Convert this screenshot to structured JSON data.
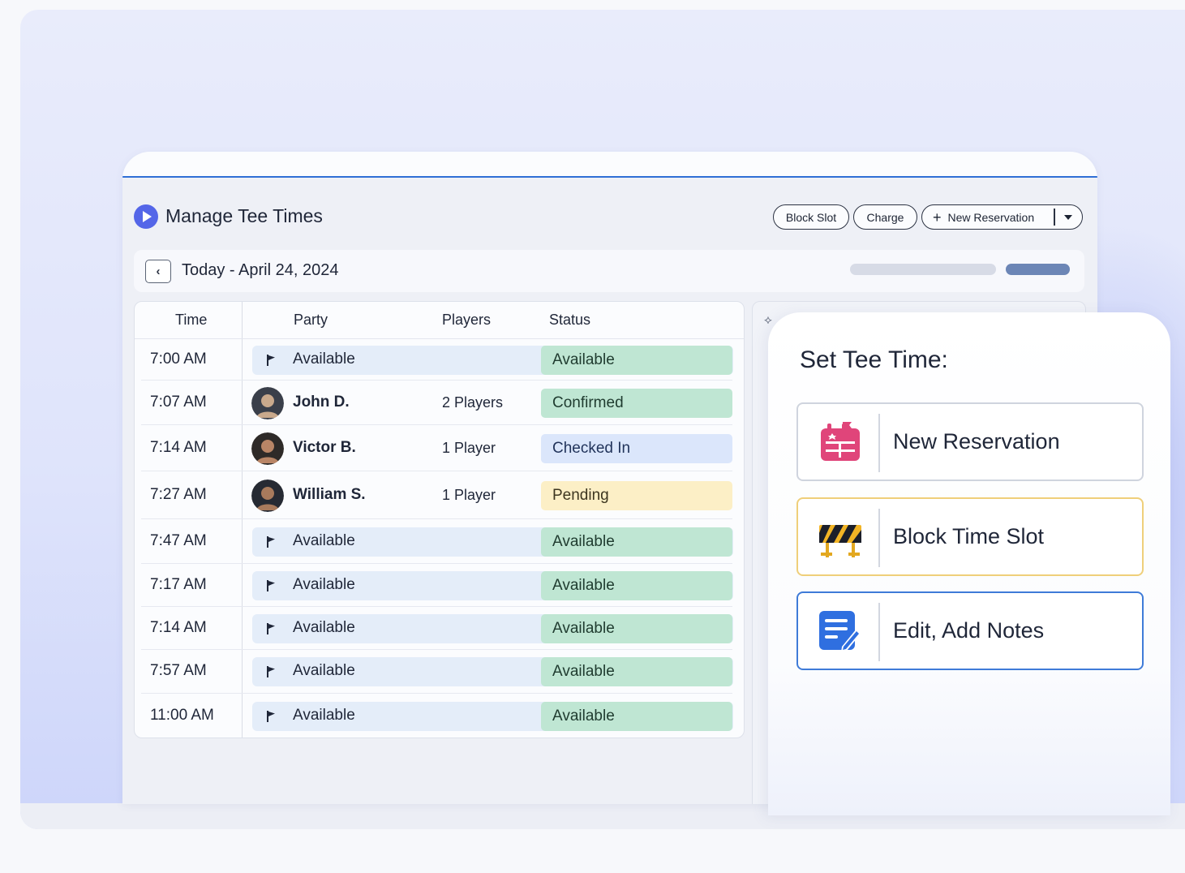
{
  "app": {
    "title": "Manage Tee Times",
    "buttons": {
      "block_slot": "Block Slot",
      "charge": "Charge",
      "new_reservation": "New Reservation"
    },
    "date_label": "Today - April 24, 2024"
  },
  "table": {
    "headers": {
      "time": "Time",
      "party": "Party",
      "players": "Players",
      "status": "Status"
    },
    "rows": [
      {
        "time": "7:00 AM",
        "party": "Available",
        "players": "",
        "status": "Available",
        "kind": "available"
      },
      {
        "time": "7:07 AM",
        "party": "John D.",
        "players": "2 Players",
        "status": "Confirmed",
        "kind": "confirmed"
      },
      {
        "time": "7:14 AM",
        "party": "Victor B.",
        "players": "1 Player",
        "status": "Checked In",
        "kind": "checked"
      },
      {
        "time": "7:27 AM",
        "party": "William S.",
        "players": "1 Player",
        "status": "Pending",
        "kind": "pending"
      },
      {
        "time": "7:47 AM",
        "party": "Available",
        "players": "",
        "status": "Available",
        "kind": "available"
      },
      {
        "time": "7:17 AM",
        "party": "Available",
        "players": "",
        "status": "Available",
        "kind": "available"
      },
      {
        "time": "7:14 AM",
        "party": "Available",
        "players": "",
        "status": "Available",
        "kind": "available"
      },
      {
        "time": "7:57 AM",
        "party": "Available",
        "players": "",
        "status": "Available",
        "kind": "available"
      },
      {
        "time": "11:00 AM",
        "party": "Available",
        "players": "",
        "status": "Available",
        "kind": "available"
      }
    ]
  },
  "panel": {
    "title": "Set Tee Time:",
    "actions": {
      "new_reservation": "New Reservation",
      "block_time_slot": "Block Time Slot",
      "edit_add_notes": "Edit, Add Notes"
    }
  },
  "colors": {
    "accent": "#5466e8",
    "available": "#bfe6d3",
    "checked_in": "#dbe6fb",
    "pending": "#fcefc6",
    "notes_border": "#3f7bd8",
    "block_border": "#efcf7a"
  }
}
